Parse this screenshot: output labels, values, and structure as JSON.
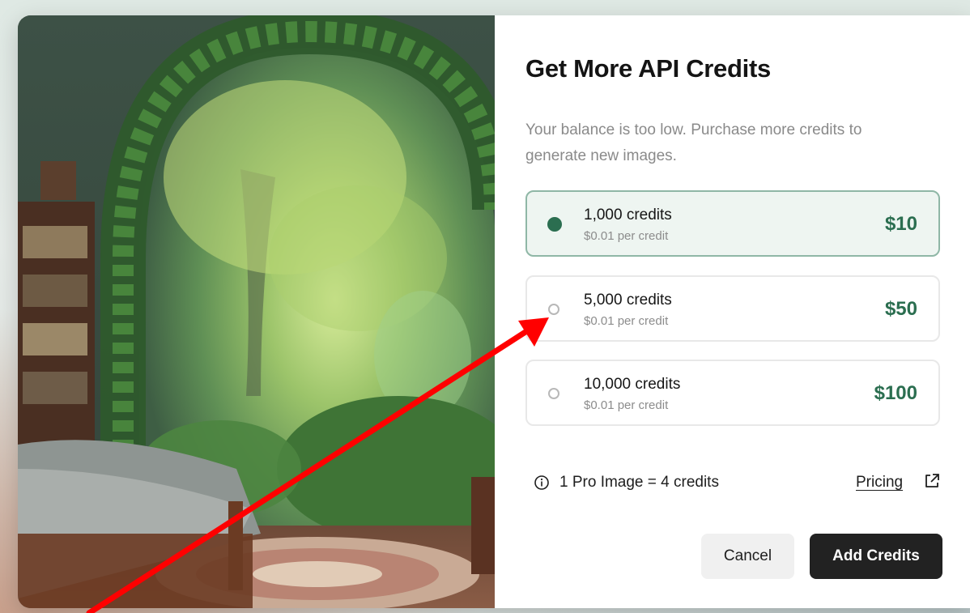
{
  "dialog": {
    "title": "Get More API Credits",
    "subtitle": "Your balance is too low. Purchase more credits to generate new images."
  },
  "options": [
    {
      "credits": "1,000 credits",
      "rate": "$0.01 per credit",
      "price": "$10",
      "selected": true
    },
    {
      "credits": "5,000 credits",
      "rate": "$0.01 per credit",
      "price": "$50",
      "selected": false
    },
    {
      "credits": "10,000 credits",
      "rate": "$0.01 per credit",
      "price": "$100",
      "selected": false
    }
  ],
  "info": {
    "text": "1 Pro Image = 4 credits",
    "icon": "info-circle-icon"
  },
  "pricing": {
    "label": "Pricing",
    "icon": "external-link-icon"
  },
  "buttons": {
    "cancel": "Cancel",
    "add": "Add Credits"
  },
  "colors": {
    "accent": "#2b6e50",
    "selected_border": "#8fb7a6",
    "selected_bg": "#eef5f1",
    "primary_button": "#222222",
    "annotation_arrow": "#ff0000"
  },
  "artwork": {
    "description_icon": "forest-bedroom-illustration"
  }
}
